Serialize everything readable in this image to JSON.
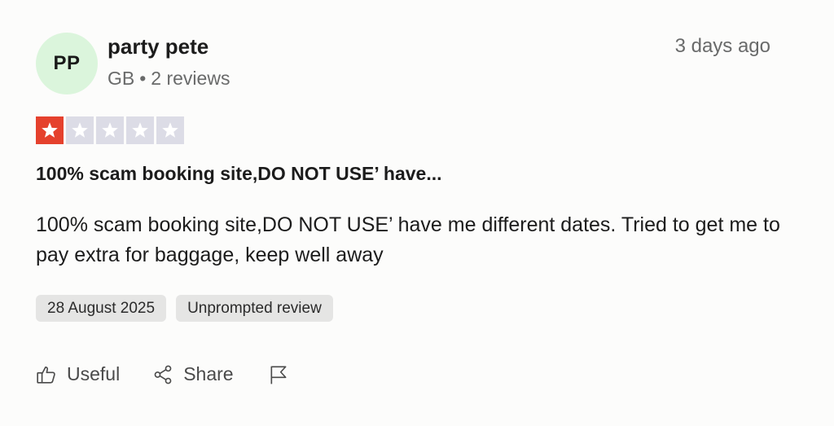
{
  "reviewer": {
    "initials": "PP",
    "name": "party pete",
    "country": "GB",
    "separator": "•",
    "review_count": "2 reviews",
    "avatar_color": "#dbf5dc"
  },
  "review": {
    "posted": "3 days ago",
    "rating": 1,
    "max_rating": 5,
    "star_filled_color": "#e5412d",
    "star_empty_color": "#dcdce6",
    "title": "100% scam booking site,DO NOT USE’ have...",
    "body": "100% scam booking site,DO NOT USE’ have me different dates. Tried to get me to pay extra for baggage, keep well away",
    "tags": {
      "date": "28 August 2025",
      "type": "Unprompted review"
    }
  },
  "actions": {
    "useful_label": "Useful",
    "useful_icon": "thumbs-up-icon",
    "share_label": "Share",
    "share_icon": "share-icon",
    "report_icon": "flag-icon"
  }
}
